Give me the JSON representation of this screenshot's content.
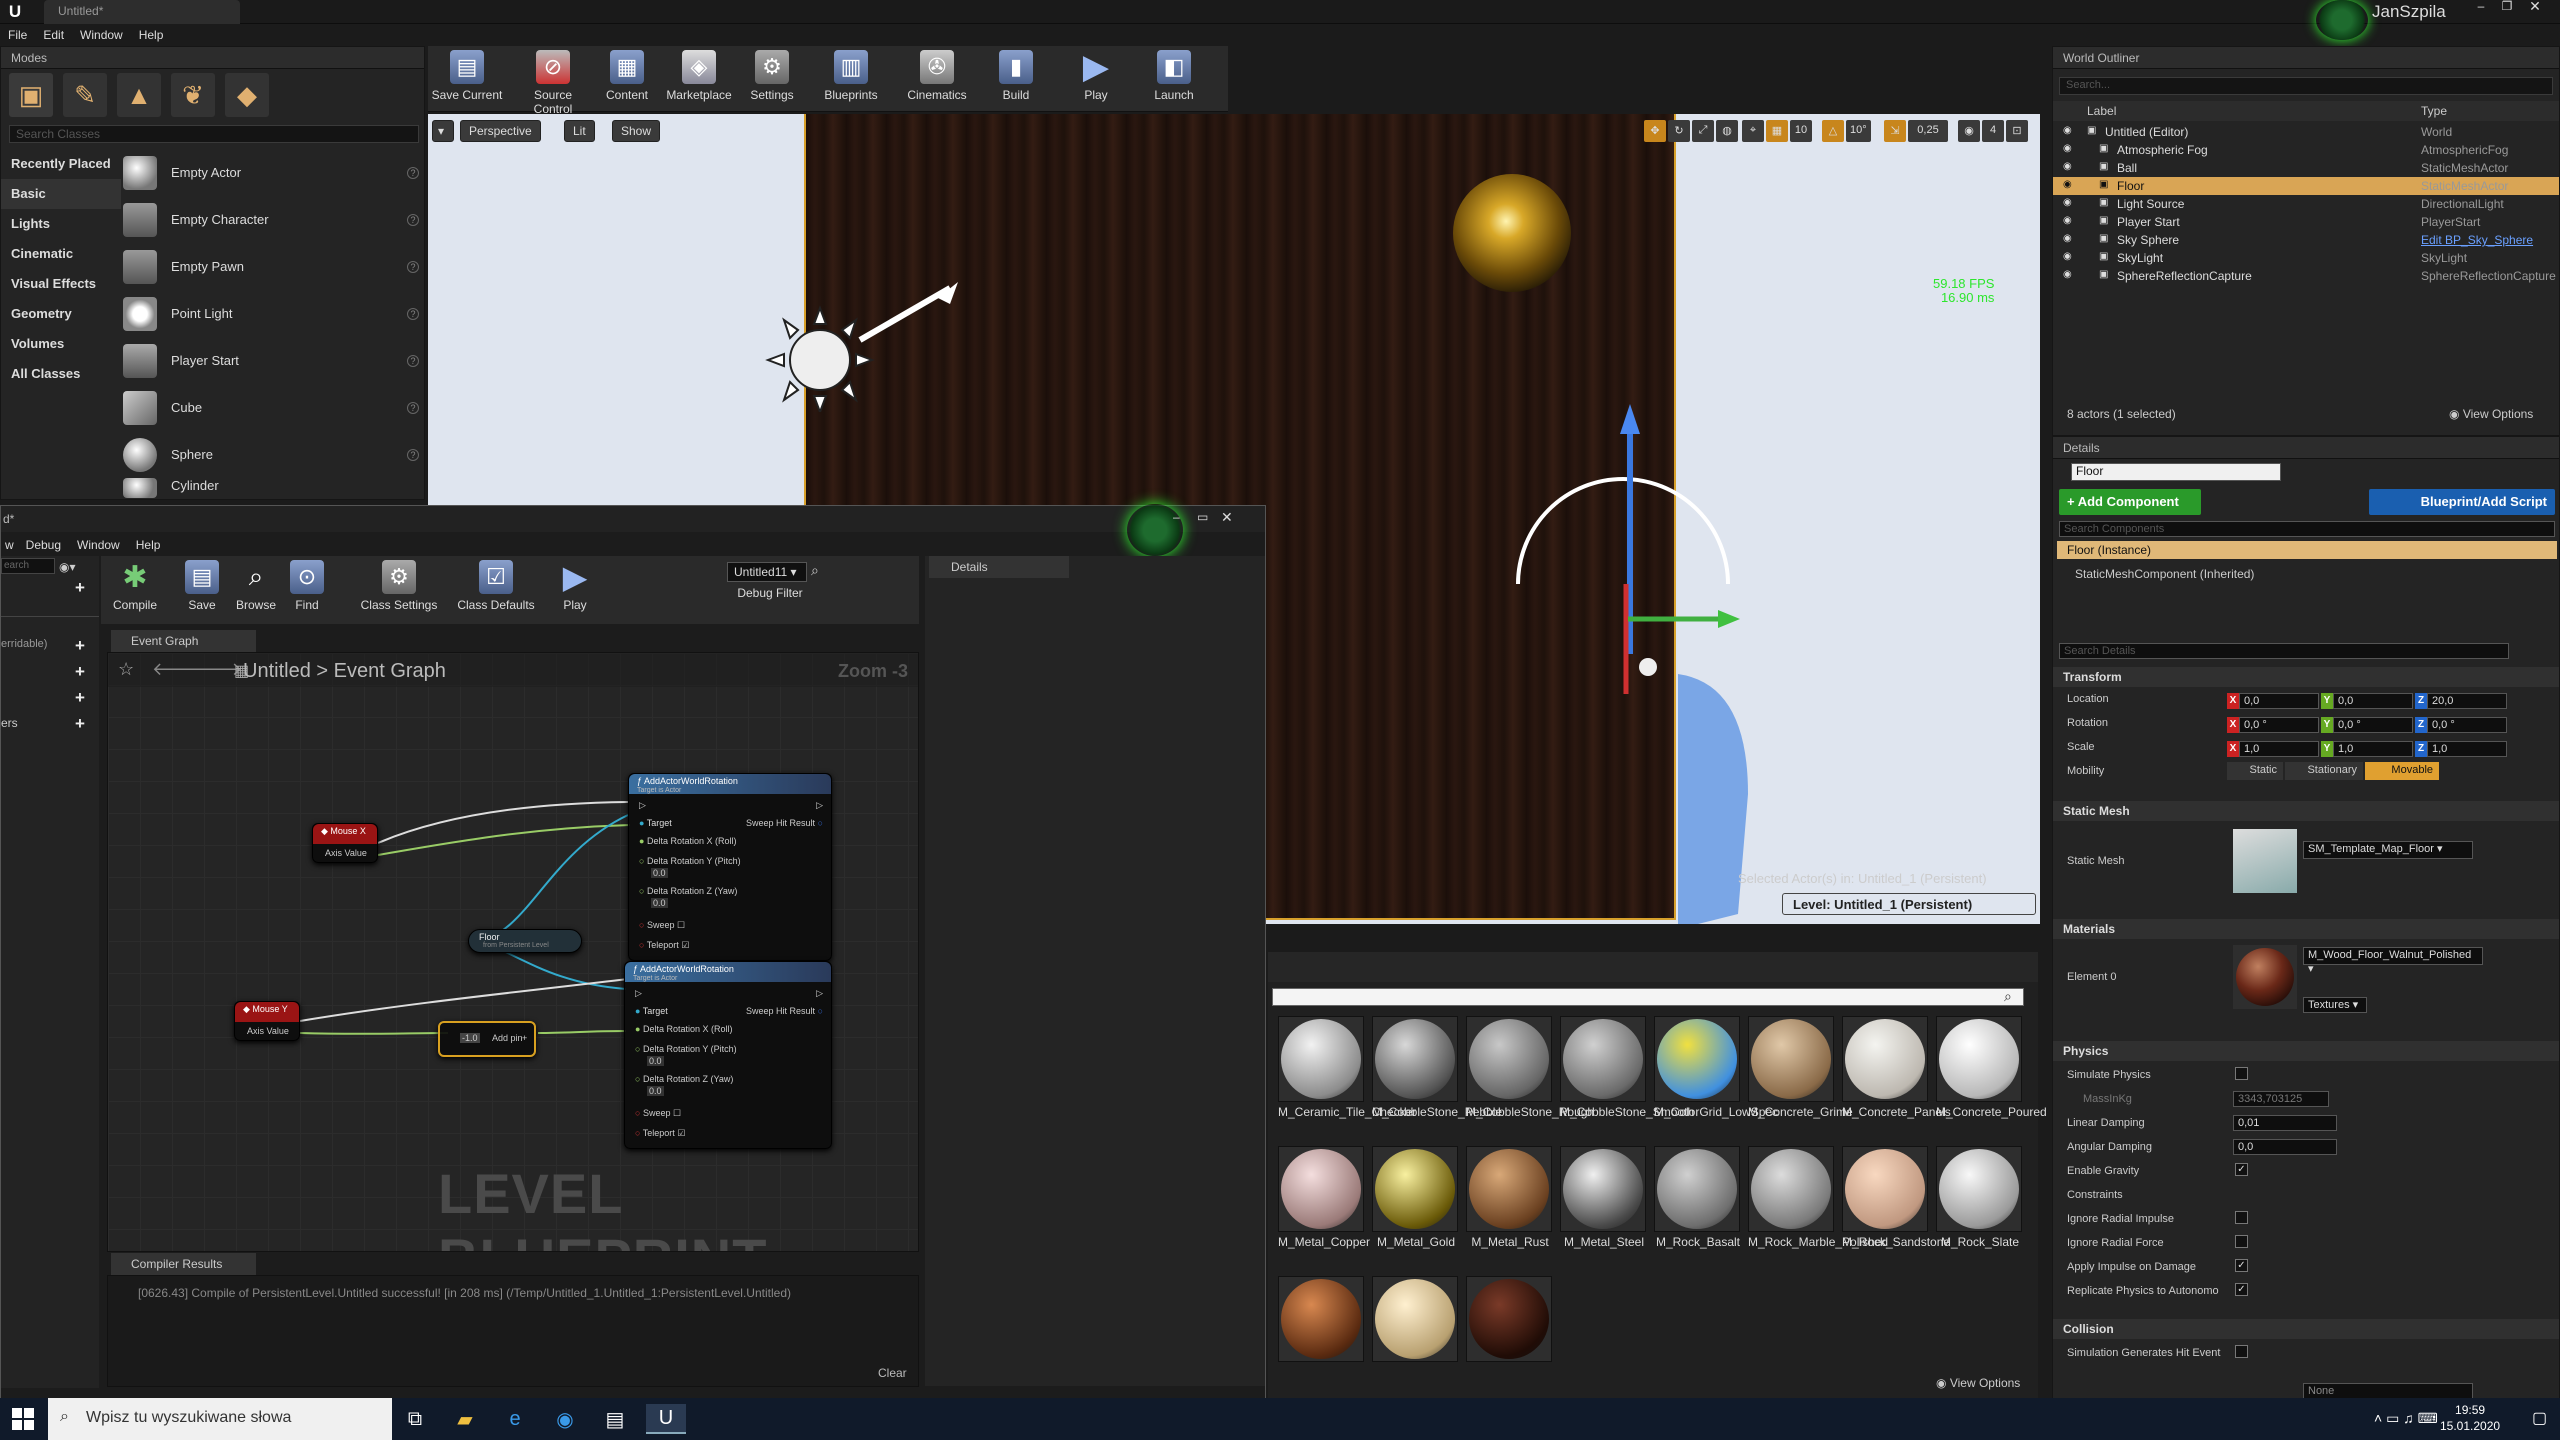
{
  "app": {
    "tab_title": "Untitled*",
    "user": "JanSzpila",
    "menu": [
      "File",
      "Edit",
      "Window",
      "Help"
    ]
  },
  "modes": {
    "tab": "Modes",
    "search_placeholder": "Search Classes",
    "categories": [
      "Recently Placed",
      "Basic",
      "Lights",
      "Cinematic",
      "Visual Effects",
      "Geometry",
      "Volumes",
      "All Classes"
    ],
    "selected_category": "Basic",
    "actors": [
      "Empty Actor",
      "Empty Character",
      "Empty Pawn",
      "Point Light",
      "Player Start",
      "Cube",
      "Sphere",
      "Cylinder"
    ]
  },
  "toolbar": {
    "items": [
      "Save Current",
      "Source Control",
      "Content",
      "Marketplace",
      "Settings",
      "Blueprints",
      "Cinematics",
      "Build",
      "Play",
      "Launch"
    ]
  },
  "viewport": {
    "perspective": "Perspective",
    "lit": "Lit",
    "show": "Show",
    "grid_snap": "10",
    "rot_snap": "10°",
    "scale_snap": "0,25",
    "cam_speed": "4",
    "fps": "59.18 FPS",
    "ms": "16.90 ms",
    "selected_actors": "Selected Actor(s) in:  Untitled_1 (Persistent)",
    "level": "Level:  Untitled_1 (Persistent)"
  },
  "blueprint": {
    "menu": [
      "w",
      "Debug",
      "Window",
      "Help"
    ],
    "title_fragment": "d*",
    "left_partial": [
      "earch",
      "erridable)",
      "ers"
    ],
    "toolbar": [
      "Compile",
      "Save",
      "Browse",
      "Find",
      "Class Settings",
      "Class Defaults",
      "Play"
    ],
    "debug_select": "Untitled11",
    "debug_filter": "Debug Filter",
    "graph_tab": "Event Graph",
    "breadcrumb_root": "Untitled",
    "breadcrumb_leaf": "Event Graph",
    "breadcrumb_sep": ">",
    "zoom": "Zoom -3",
    "watermark": "LEVEL BLUEPRINT",
    "details_tab": "Details",
    "nodes": {
      "mouse_x": "Mouse X",
      "mouse_y": "Mouse Y",
      "axis_value": "Axis Value",
      "floor": "Floor",
      "floor_sub": "from Persistent Level",
      "add_rot_title": "AddActorWorldRotation",
      "add_rot_sub": "Target is Actor",
      "target": "Target",
      "sweep_hit": "Sweep Hit Result",
      "roll": "Delta Rotation X (Roll)",
      "pitch": "Delta Rotation Y (Pitch)",
      "yaw": "Delta Rotation Z (Yaw)",
      "zero": "0.0",
      "sweep": "Sweep",
      "teleport": "Teleport",
      "neg1": "-1.0",
      "add_pin": "Add pin",
      "plus": "+"
    },
    "compiler_tab": "Compiler Results",
    "compiler_msg": "[0626.43] Compile of PersistentLevel.Untitled successful! [in 208 ms] (/Temp/Untitled_1.Untitled_1:PersistentLevel.Untitled)",
    "clear": "Clear"
  },
  "content": {
    "view_options": "View Options",
    "assets": [
      {
        "name": "M_Ceramic_Tile_Checker",
        "c1": "#f2f2f2",
        "c2": "#8c8c8c"
      },
      {
        "name": "M_CobbleStone_Pebble",
        "c1": "#d8d8d8",
        "c2": "#555555"
      },
      {
        "name": "M_CobbleStone_Rough",
        "c1": "#c8c8c8",
        "c2": "#666666"
      },
      {
        "name": "M_CobbleStone_Smooth",
        "c1": "#d0d0d0",
        "c2": "#6a6a6a"
      },
      {
        "name": "M_ColorGrid_LowSpec",
        "c1": "#f0e040",
        "c2": "#4090e0"
      },
      {
        "name": "M_Concrete_Grime",
        "c1": "#e0c8a8",
        "c2": "#8a6a48"
      },
      {
        "name": "M_Concrete_Panels",
        "c1": "#f4f4f0",
        "c2": "#bdb8b0"
      },
      {
        "name": "M_Concrete_Poured",
        "c1": "#ffffff",
        "c2": "#b8b8b8"
      },
      {
        "name": "M_Metal_Copper",
        "c1": "#f4dede",
        "c2": "#9a7a78"
      },
      {
        "name": "M_Metal_Gold",
        "c1": "#f8f0a0",
        "c2": "#6a5a08"
      },
      {
        "name": "M_Metal_Rust",
        "c1": "#d8a878",
        "c2": "#6a4020"
      },
      {
        "name": "M_Metal_Steel",
        "c1": "#f0f0f0",
        "c2": "#4a4a4a"
      },
      {
        "name": "M_Rock_Basalt",
        "c1": "#d0d0d0",
        "c2": "#6e6e6e"
      },
      {
        "name": "M_Rock_Marble_Polished",
        "c1": "#dcdcdc",
        "c2": "#7a7a7a"
      },
      {
        "name": "M_Rock_Sandstone",
        "c1": "#f8d8c0",
        "c2": "#c09880"
      },
      {
        "name": "M_Rock_Slate",
        "c1": "#f8f8f8",
        "c2": "#9a9a9a"
      },
      {
        "name": "",
        "c1": "#d88850",
        "c2": "#5a2a10"
      },
      {
        "name": "",
        "c1": "#fff0d0",
        "c2": "#b8a070"
      },
      {
        "name": "",
        "c1": "#7a3a28",
        "c2": "#200c06"
      }
    ]
  },
  "outliner": {
    "tab": "World Outliner",
    "search_placeholder": "Search...",
    "col_label": "Label",
    "col_type": "Type",
    "rows": [
      {
        "label": "Untitled (Editor)",
        "type": "World",
        "indent": 0
      },
      {
        "label": "Atmospheric Fog",
        "type": "AtmosphericFog",
        "indent": 1
      },
      {
        "label": "Ball",
        "type": "StaticMeshActor",
        "indent": 1
      },
      {
        "label": "Floor",
        "type": "StaticMeshActor",
        "indent": 1
      },
      {
        "label": "Light Source",
        "type": "DirectionalLight",
        "indent": 1
      },
      {
        "label": "Player Start",
        "type": "PlayerStart",
        "indent": 1
      },
      {
        "label": "Sky Sphere",
        "type": "Edit BP_Sky_Sphere",
        "indent": 1
      },
      {
        "label": "SkyLight",
        "type": "SkyLight",
        "indent": 1
      },
      {
        "label": "SphereReflectionCapture",
        "type": "SphereReflectionCapture",
        "indent": 1
      }
    ],
    "selected_row": "Floor",
    "status": "8 actors (1 selected)",
    "view_options": "View Options"
  },
  "details": {
    "tab": "Details",
    "name": "Floor",
    "add_component": "+ Add Component",
    "blueprint_script": "Blueprint/Add Script",
    "search_components": "Search Components",
    "instance": "Floor (Instance)",
    "component": "StaticMeshComponent (Inherited)",
    "search_details": "Search Details",
    "transform": "Transform",
    "location": "Location",
    "rotation": "Rotation",
    "scale": "Scale",
    "mobility": "Mobility",
    "loc": [
      "0,0",
      "0,0",
      "20,0"
    ],
    "rot": [
      "0,0 °",
      "0,0 °",
      "0,0 °"
    ],
    "scl": [
      "1,0",
      "1,0",
      "1,0"
    ],
    "mob_static": "Static",
    "mob_stationary": "Stationary",
    "mob_movable": "Movable",
    "static_mesh_section": "Static Mesh",
    "static_mesh_label": "Static Mesh",
    "static_mesh_value": "SM_Template_Map_Floor",
    "materials": "Materials",
    "element0": "Element 0",
    "material_value": "M_Wood_Floor_Walnut_Polished",
    "textures": "Textures",
    "physics": "Physics",
    "simulate_physics": "Simulate Physics",
    "mass": "MassInKg",
    "mass_value": "3343,703125",
    "linear_damping": "Linear Damping",
    "linear_value": "0,01",
    "angular_damping": "Angular Damping",
    "angular_value": "0,0",
    "enable_gravity": "Enable Gravity",
    "constraints": "Constraints",
    "ignore_radial_impulse": "Ignore Radial Impulse",
    "ignore_radial_force": "Ignore Radial Force",
    "apply_impulse": "Apply Impulse on Damage",
    "replicate": "Replicate Physics to Autonomo",
    "collision": "Collision",
    "sim_hit": "Simulation Generates Hit Event",
    "none": "None"
  },
  "taskbar": {
    "search_placeholder": "Wpisz tu wyszukiwane słowa",
    "time": "19:59",
    "date": "15.01.2020"
  }
}
